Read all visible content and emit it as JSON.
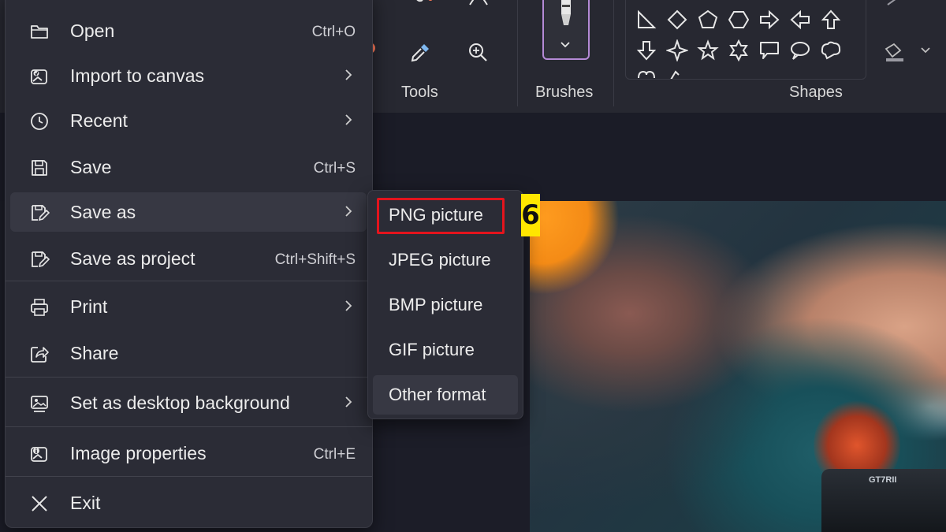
{
  "ribbon": {
    "groups": {
      "tools_label": "Tools",
      "brushes_label": "Brushes",
      "shapes_label": "Shapes"
    }
  },
  "menu": {
    "items": [
      {
        "label": "Open",
        "shortcut": "Ctrl+O",
        "icon": "folder-icon"
      },
      {
        "label": "Import to canvas",
        "shortcut": "",
        "icon": "image-import-icon",
        "submenu": true
      },
      {
        "label": "Recent",
        "shortcut": "",
        "icon": "clock-icon",
        "submenu": true
      },
      {
        "label": "Save",
        "shortcut": "Ctrl+S",
        "icon": "save-icon"
      },
      {
        "label": "Save as",
        "shortcut": "",
        "icon": "save-as-icon",
        "submenu": true
      },
      {
        "label": "Save as project",
        "shortcut": "Ctrl+Shift+S",
        "icon": "save-project-icon"
      },
      {
        "label": "Print",
        "shortcut": "",
        "icon": "printer-icon",
        "submenu": true
      },
      {
        "label": "Share",
        "shortcut": "",
        "icon": "share-icon"
      },
      {
        "label": "Set as desktop background",
        "shortcut": "",
        "icon": "desktop-background-icon",
        "submenu": true
      },
      {
        "label": "Image properties",
        "shortcut": "Ctrl+E",
        "icon": "image-properties-icon"
      },
      {
        "label": "Exit",
        "shortcut": "",
        "icon": "close-icon"
      }
    ]
  },
  "submenu": {
    "items": [
      {
        "label": "PNG picture"
      },
      {
        "label": "JPEG picture"
      },
      {
        "label": "BMP picture"
      },
      {
        "label": "GIF picture"
      },
      {
        "label": "Other format"
      }
    ]
  },
  "annotation": {
    "step_number": "6",
    "highlight_color": "#e4141d",
    "badge_color": "#ffe600"
  },
  "photo": {
    "camera_text": "GT7RII"
  }
}
